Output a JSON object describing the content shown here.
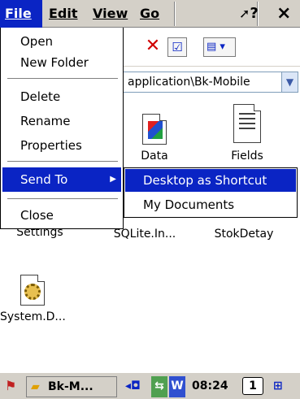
{
  "menubar": {
    "file": "File",
    "edit": "Edit",
    "view": "View",
    "go": "Go",
    "help_icon": "?",
    "close": "×"
  },
  "file_menu": {
    "items": [
      "Open",
      "New Folder",
      "Delete",
      "Rename",
      "Properties",
      "Send To",
      "Close"
    ]
  },
  "submenu": {
    "items": [
      "Desktop as Shortcut",
      "My Documents"
    ]
  },
  "address": "application\\Bk-Mobile",
  "files": [
    {
      "label": "Data"
    },
    {
      "label": "Fields"
    },
    {
      "label": "Settings"
    },
    {
      "label": "SQLite.In..."
    },
    {
      "label": "StokDetay"
    },
    {
      "label": "System.D..."
    }
  ],
  "taskbar": {
    "window_button": "Bk-M...",
    "time": "08:24",
    "badge": "1"
  },
  "colors": {
    "highlight": "#0a24c4",
    "chrome": "#d4d0c8"
  }
}
